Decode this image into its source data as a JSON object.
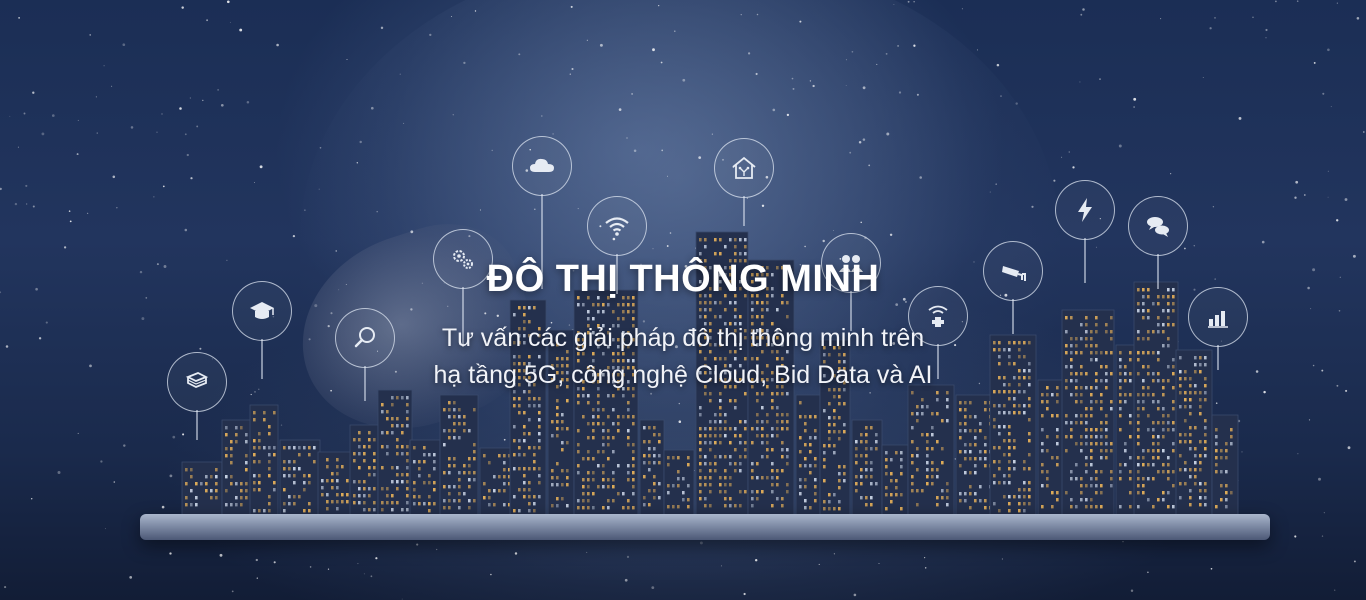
{
  "hero": {
    "title": "ĐÔ THỊ THÔNG MINH",
    "subtitle_line1": "Tư vấn các giải pháp đô thị thông minh trên",
    "subtitle_line2": "hạ tầng 5G, công nghệ Cloud, Bid Data và AI"
  },
  "icons": [
    "book-icon",
    "graduation-cap-icon",
    "search-icon",
    "gears-icon",
    "cloud-icon",
    "wifi-icon",
    "smart-home-icon",
    "people-icon",
    "medical-wifi-icon",
    "cctv-camera-icon",
    "lightning-icon",
    "chat-bubbles-icon",
    "bar-chart-icon"
  ],
  "colors": {
    "background": "#1b2e55",
    "text": "#ffffff",
    "icon_stroke": "#dce4f0",
    "window_light": "#e8b25a"
  }
}
